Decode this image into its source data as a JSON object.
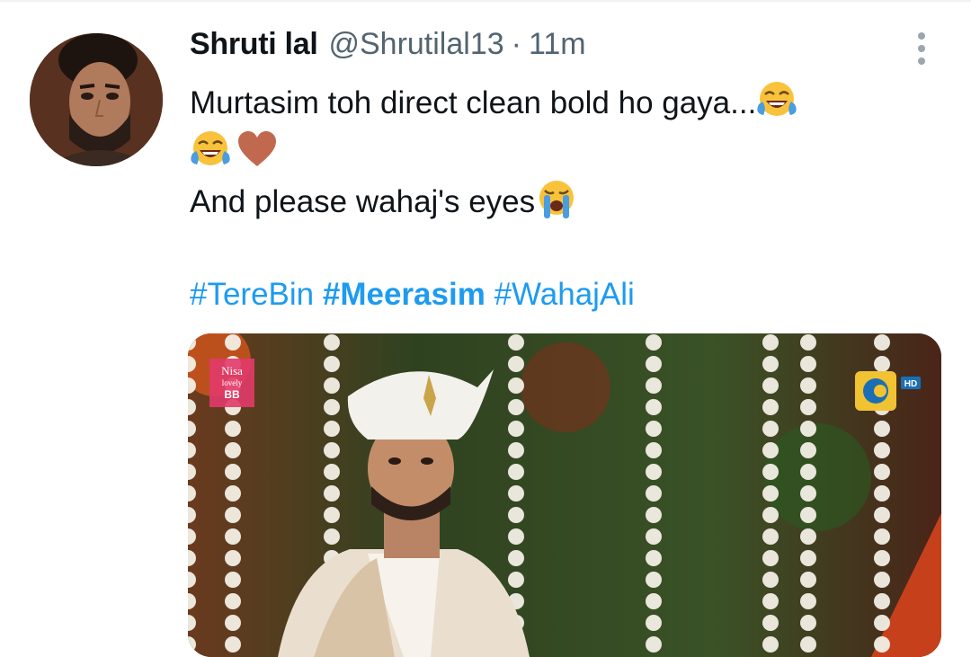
{
  "tweet": {
    "display_name": "Shruti lal",
    "handle": "@Shrutilal13",
    "separator": "·",
    "time": "11m",
    "line1": "Murtasim toh direct clean bold ho gaya...",
    "line3": "And please wahaj's eyes",
    "hashtags": [
      "#TereBin",
      "#Meerasim",
      "#WahajAli"
    ]
  },
  "media": {
    "channel_logo_text": "HD",
    "sponsor_text": [
      "Nisa",
      "lovely",
      "BB"
    ]
  },
  "icons": {
    "avatar": "user-avatar",
    "more": "more-options-icon",
    "emoji_laugh": "face-with-tears-of-joy",
    "emoji_heart": "brown-heart",
    "emoji_cry": "loudly-crying-face"
  },
  "colors": {
    "link": "#1d9bf0",
    "text": "#0f1419",
    "secondary": "#536471",
    "heart": "#c1694f"
  }
}
